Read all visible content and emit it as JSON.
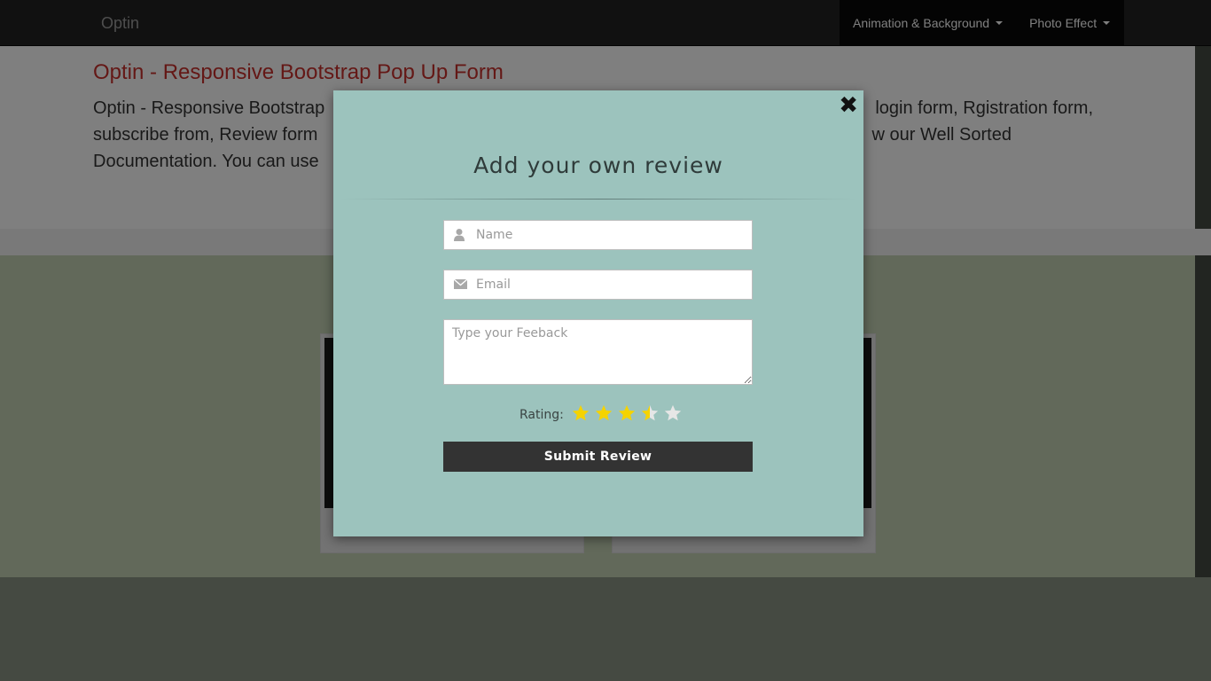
{
  "navbar": {
    "brand": "Optin",
    "menu": [
      {
        "label": "Animation & Background"
      },
      {
        "label": "Photo Effect"
      }
    ]
  },
  "hero": {
    "title": "Optin - Responsive Bootstrap Pop Up Form",
    "text_line1_left": "Optin - Responsive Bootstrap",
    "text_line1_right": "login form, Rgistration form,",
    "text_line2_left": "subscribe from, Review form",
    "text_line2_right": "w our Well Sorted",
    "text_line3_left": "Documentation. You can use"
  },
  "modal": {
    "title": "Add your own review",
    "close_symbol": "✖",
    "name_placeholder": "Name",
    "email_placeholder": "Email",
    "feedback_placeholder": "Type your Feeback",
    "rating_label": "Rating:",
    "rating_value": 3.5,
    "rating_max": 5,
    "submit_label": "Submit Review",
    "icons": [
      "user-icon",
      "envelope-icon"
    ]
  },
  "colors": {
    "modal_bg": "#9cc3bd",
    "star_filled": "#f5d300",
    "star_empty": "#e6e6e6",
    "submit_bg": "#333333",
    "hero_title": "#c9302c"
  }
}
